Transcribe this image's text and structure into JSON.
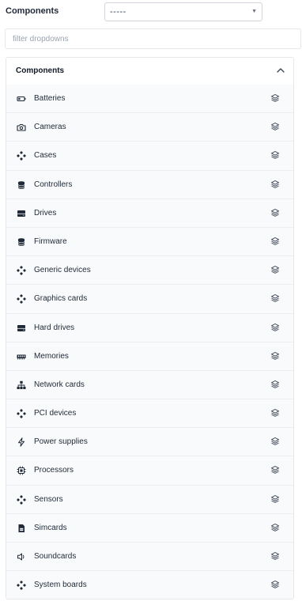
{
  "header": {
    "label": "Components"
  },
  "select": {
    "value": "-----"
  },
  "filter": {
    "placeholder": "filter dropdowns",
    "value": ""
  },
  "panel": {
    "title": "Components",
    "items": [
      {
        "label": "Batteries",
        "icon": "battery-icon"
      },
      {
        "label": "Cameras",
        "icon": "camera-icon"
      },
      {
        "label": "Cases",
        "icon": "component-icon"
      },
      {
        "label": "Controllers",
        "icon": "database-icon"
      },
      {
        "label": "Drives",
        "icon": "drive-icon"
      },
      {
        "label": "Firmware",
        "icon": "database-icon"
      },
      {
        "label": "Generic devices",
        "icon": "component-icon"
      },
      {
        "label": "Graphics cards",
        "icon": "component-icon"
      },
      {
        "label": "Hard drives",
        "icon": "drive-icon"
      },
      {
        "label": "Memories",
        "icon": "memory-icon"
      },
      {
        "label": "Network cards",
        "icon": "network-icon"
      },
      {
        "label": "PCI devices",
        "icon": "component-icon"
      },
      {
        "label": "Power supplies",
        "icon": "bolt-icon"
      },
      {
        "label": "Processors",
        "icon": "cpu-icon"
      },
      {
        "label": "Sensors",
        "icon": "component-icon"
      },
      {
        "label": "Simcards",
        "icon": "simcard-icon"
      },
      {
        "label": "Soundcards",
        "icon": "speaker-icon"
      },
      {
        "label": "System boards",
        "icon": "component-icon"
      }
    ]
  }
}
